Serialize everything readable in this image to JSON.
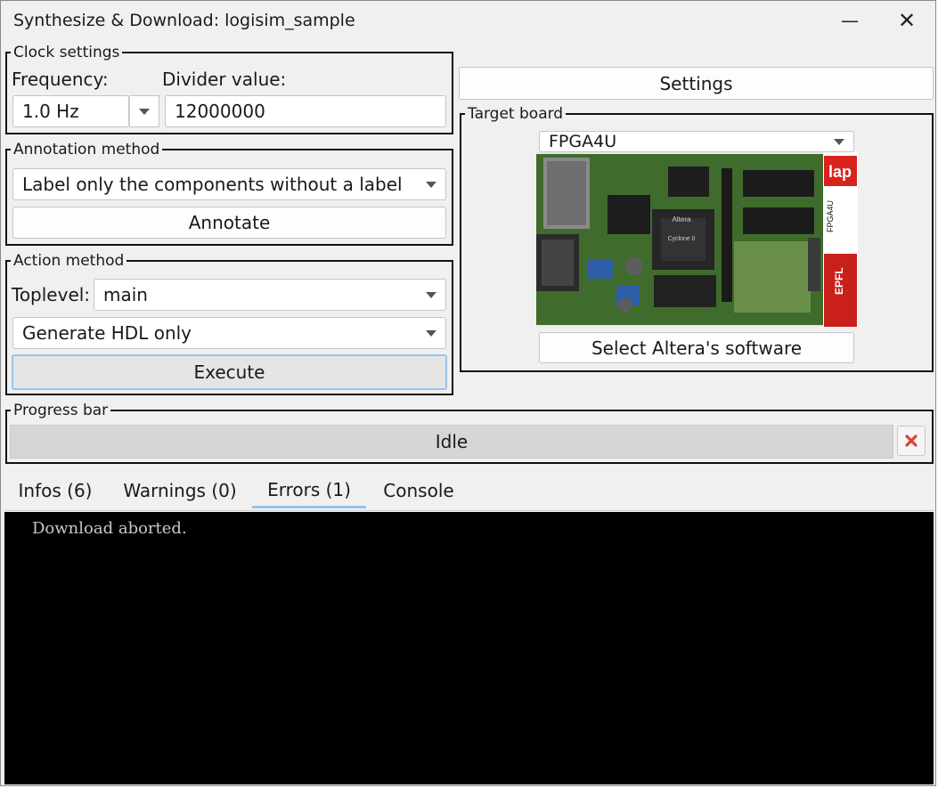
{
  "window": {
    "title": "Synthesize & Download: logisim_sample"
  },
  "clock": {
    "legend": "Clock settings",
    "frequency_label": "Frequency:",
    "frequency_value": "1.0 Hz",
    "divider_label": "Divider value:",
    "divider_value": "12000000"
  },
  "annotation": {
    "legend": "Annotation method",
    "method_value": "Label only the components without a label",
    "annotate_label": "Annotate"
  },
  "action": {
    "legend": "Action method",
    "toplevel_label": "Toplevel:",
    "toplevel_value": "main",
    "mode_value": "Generate HDL only",
    "execute_label": "Execute"
  },
  "settings_label": "Settings",
  "target": {
    "legend": "Target board",
    "board_value": "FPGA4U",
    "select_software_label": "Select Altera's software",
    "board_image_lettering": [
      "Altera",
      "Cyclone II",
      "lap",
      "FPGA4U",
      "EPFL"
    ]
  },
  "progress": {
    "legend": "Progress bar",
    "status": "Idle",
    "cancel_icon": "red-x-icon"
  },
  "tabs": [
    {
      "label": "Infos (6)"
    },
    {
      "label": "Warnings (0)"
    },
    {
      "label": "Errors (1)"
    },
    {
      "label": "Console"
    }
  ],
  "active_tab": "Errors (1)",
  "console": {
    "text": "Download aborted."
  },
  "colors": {
    "accent": "#99c4ea",
    "console_bg": "#000000",
    "cancel": "#e0403a"
  }
}
